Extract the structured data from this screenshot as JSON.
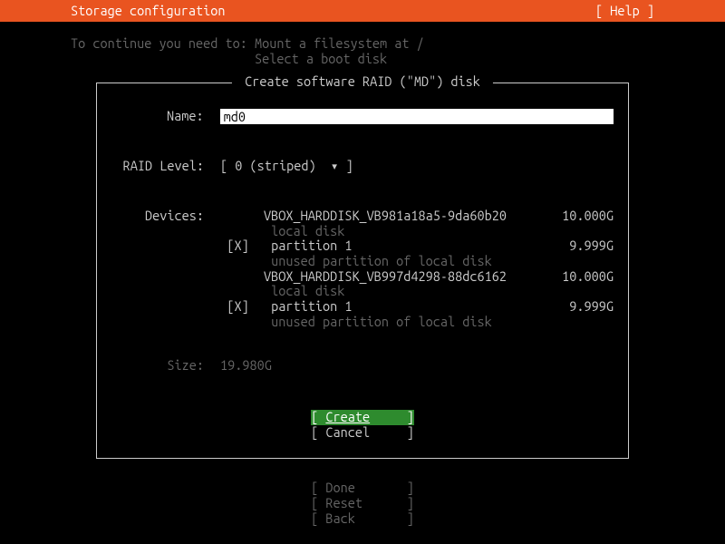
{
  "header": {
    "title": "Storage configuration",
    "help": "[ Help ]"
  },
  "hint": {
    "prefix": "To continue you need to: ",
    "line1": "Mount a filesystem at /",
    "line2": "Select a boot disk"
  },
  "dialog": {
    "title": " Create software RAID (\"MD\") disk ",
    "name_label": "Name:",
    "name_value": "md0",
    "raid_label": "RAID Level:",
    "raid_value": "[ 0 (striped)  ▾ ]",
    "devices_label": "Devices:",
    "devices": [
      {
        "disk_name": "VBOX_HARDDISK_VB981a18a5-9da60b20",
        "disk_size": "10.000G",
        "disk_sub": "local disk",
        "checked": "[X]",
        "part_name": "partition 1",
        "part_size": "9.999G",
        "part_sub": "unused partition of local disk"
      },
      {
        "disk_name": "VBOX_HARDDISK_VB997d4298-88dc6162",
        "disk_size": "10.000G",
        "disk_sub": "local disk",
        "checked": "[X]",
        "part_name": "partition 1",
        "part_size": "9.999G",
        "part_sub": "unused partition of local disk"
      }
    ],
    "size_label": "Size:",
    "size_value": "19.980G",
    "create": "Create",
    "cancel": "Cancel"
  },
  "footer": {
    "done": "Done",
    "reset": "Reset",
    "back": "Back"
  }
}
